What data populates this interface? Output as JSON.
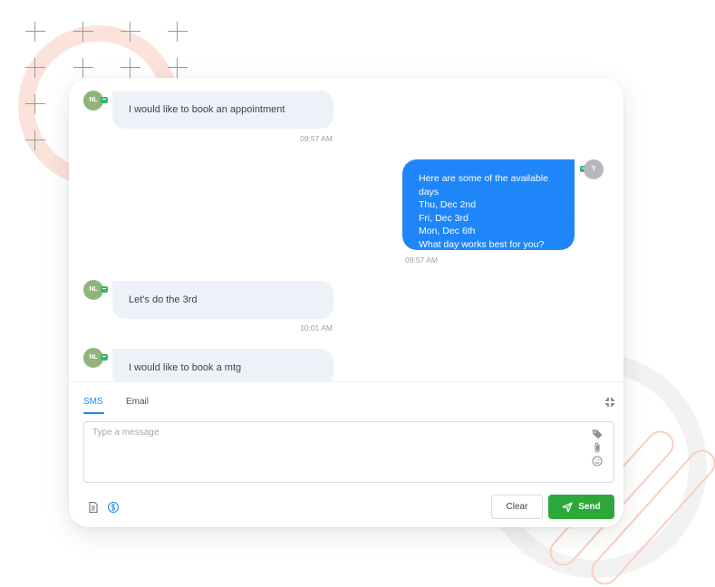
{
  "messages": [
    {
      "direction": "inbound",
      "avatar": "NL",
      "text": "I would like to book an appointment",
      "time": "09:57 AM"
    },
    {
      "direction": "outbound",
      "avatar": "?",
      "lines": [
        "Here are some of the available days",
        "Thu, Dec 2nd",
        "Fri, Dec 3rd",
        "Mon, Dec 6th",
        "What day works best for you?"
      ],
      "time": "09:57 AM"
    },
    {
      "direction": "inbound",
      "avatar": "NL",
      "text": "Let's do the 3rd",
      "time": "10:01 AM"
    },
    {
      "direction": "inbound",
      "avatar": "NL",
      "text": "I would like to book a mtg",
      "time": ""
    }
  ],
  "composer": {
    "tabs": [
      {
        "label": "SMS",
        "active": true
      },
      {
        "label": "Email",
        "active": false
      }
    ],
    "placeholder": "Type a message",
    "clear_label": "Clear",
    "send_label": "Send",
    "side_icons": [
      "tag-icon",
      "paperclip-icon",
      "emoji-icon"
    ],
    "footer_icons": [
      "template-icon",
      "payment-icon"
    ],
    "minimize_icon": "minimize-icon"
  },
  "colors": {
    "accent": "#1f86f9",
    "send": "#2ca83a",
    "inbound_bubble": "#eef1f8",
    "avatar_contact": "#8fb67a",
    "avatar_user": "#b4b7bd",
    "channel_badge": "#2eb872"
  }
}
